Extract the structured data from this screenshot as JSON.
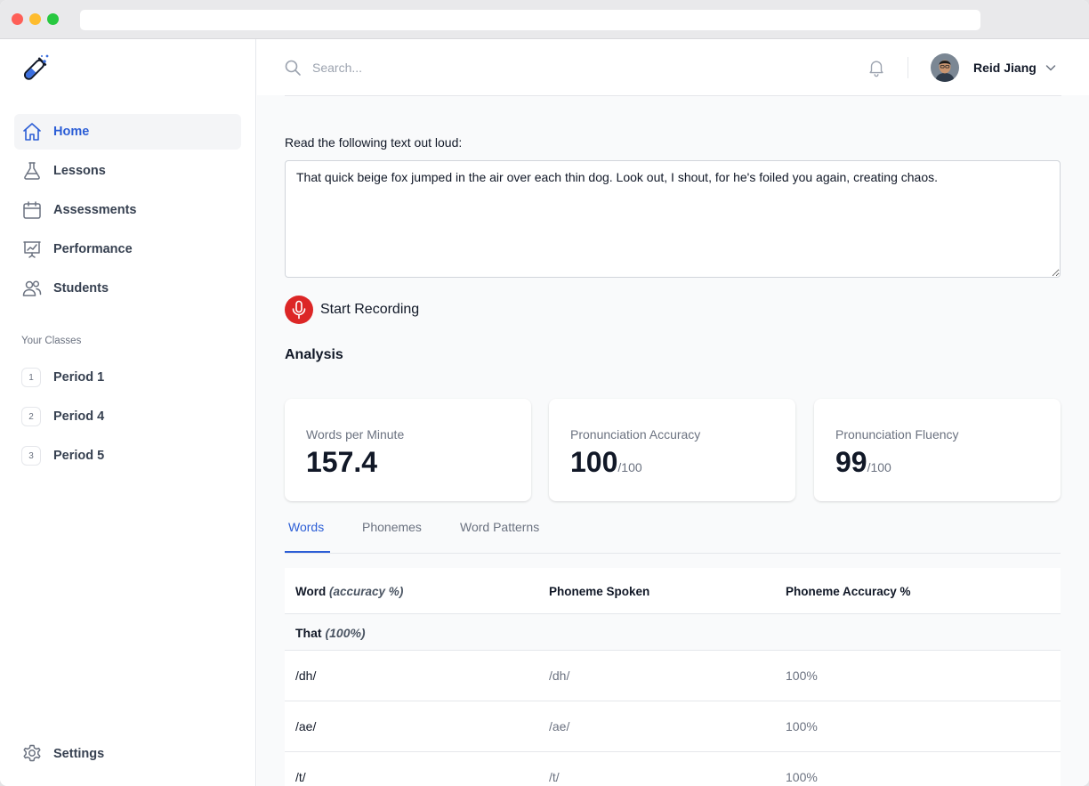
{
  "sidebar": {
    "nav": [
      {
        "label": "Home",
        "icon": "home-icon",
        "active": true
      },
      {
        "label": "Lessons",
        "icon": "beaker-icon"
      },
      {
        "label": "Assessments",
        "icon": "calendar-icon"
      },
      {
        "label": "Performance",
        "icon": "presentation-chart-icon"
      },
      {
        "label": "Students",
        "icon": "users-icon"
      }
    ],
    "section_label": "Your Classes",
    "classes": [
      {
        "badge": "1",
        "label": "Period 1"
      },
      {
        "badge": "2",
        "label": "Period 4"
      },
      {
        "badge": "3",
        "label": "Period 5"
      }
    ],
    "settings_label": "Settings"
  },
  "header": {
    "search_placeholder": "Search...",
    "user_name": "Reid Jiang"
  },
  "reading": {
    "prompt": "Read the following text out loud:",
    "passage": "That quick beige fox jumped in the air over each thin dog. Look out, I shout, for he's foiled you again, creating chaos.",
    "record_label": "Start Recording"
  },
  "analysis": {
    "title": "Analysis",
    "cards": [
      {
        "label": "Words per Minute",
        "value": "157.4",
        "unit": ""
      },
      {
        "label": "Pronunciation Accuracy",
        "value": "100",
        "unit": "/100"
      },
      {
        "label": "Pronunciation Fluency",
        "value": "99",
        "unit": "/100"
      }
    ]
  },
  "tabs": [
    {
      "label": "Words",
      "active": true
    },
    {
      "label": "Phonemes"
    },
    {
      "label": "Word Patterns"
    }
  ],
  "table": {
    "headers": {
      "word": "Word",
      "word_suffix": "(accuracy %)",
      "phoneme_spoken": "Phoneme Spoken",
      "phoneme_accuracy": "Phoneme Accuracy %"
    },
    "group": {
      "word": "That",
      "accuracy": "(100%)"
    },
    "rows": [
      {
        "phoneme": "/dh/",
        "spoken": "/dh/",
        "accuracy": "100%"
      },
      {
        "phoneme": "/ae/",
        "spoken": "/ae/",
        "accuracy": "100%"
      },
      {
        "phoneme": "/t/",
        "spoken": "/t/",
        "accuracy": "100%"
      }
    ]
  },
  "colors": {
    "accent": "#2c5ed6",
    "record": "#dc2626"
  }
}
